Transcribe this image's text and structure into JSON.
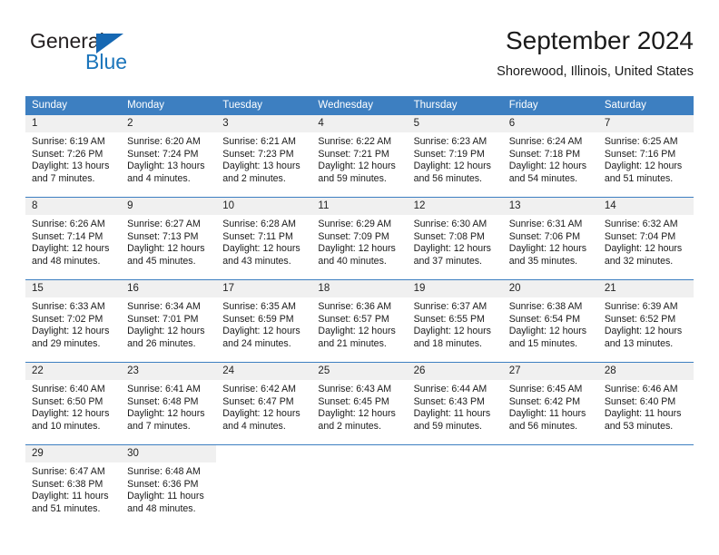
{
  "brand": {
    "name_top": "General",
    "name_bottom": "Blue",
    "triangle_color": "#1668b3",
    "blue_color": "#1b75bb"
  },
  "header": {
    "title": "September 2024",
    "location": "Shorewood, Illinois, United States"
  },
  "theme": {
    "header_bg": "#3d7fc1",
    "daynum_bg": "#f0f0f0",
    "grid_line": "#3d7fc1",
    "text": "#1a1a1a"
  },
  "weekday_headers": [
    "Sunday",
    "Monday",
    "Tuesday",
    "Wednesday",
    "Thursday",
    "Friday",
    "Saturday"
  ],
  "labels": {
    "sunrise_prefix": "Sunrise: ",
    "sunset_prefix": "Sunset: ",
    "daylight_prefix": "Daylight: "
  },
  "weeks": [
    [
      {
        "day": "1",
        "sunrise": "Sunrise: 6:19 AM",
        "sunset": "Sunset: 7:26 PM",
        "daylight": "Daylight: 13 hours and 7 minutes."
      },
      {
        "day": "2",
        "sunrise": "Sunrise: 6:20 AM",
        "sunset": "Sunset: 7:24 PM",
        "daylight": "Daylight: 13 hours and 4 minutes."
      },
      {
        "day": "3",
        "sunrise": "Sunrise: 6:21 AM",
        "sunset": "Sunset: 7:23 PM",
        "daylight": "Daylight: 13 hours and 2 minutes."
      },
      {
        "day": "4",
        "sunrise": "Sunrise: 6:22 AM",
        "sunset": "Sunset: 7:21 PM",
        "daylight": "Daylight: 12 hours and 59 minutes."
      },
      {
        "day": "5",
        "sunrise": "Sunrise: 6:23 AM",
        "sunset": "Sunset: 7:19 PM",
        "daylight": "Daylight: 12 hours and 56 minutes."
      },
      {
        "day": "6",
        "sunrise": "Sunrise: 6:24 AM",
        "sunset": "Sunset: 7:18 PM",
        "daylight": "Daylight: 12 hours and 54 minutes."
      },
      {
        "day": "7",
        "sunrise": "Sunrise: 6:25 AM",
        "sunset": "Sunset: 7:16 PM",
        "daylight": "Daylight: 12 hours and 51 minutes."
      }
    ],
    [
      {
        "day": "8",
        "sunrise": "Sunrise: 6:26 AM",
        "sunset": "Sunset: 7:14 PM",
        "daylight": "Daylight: 12 hours and 48 minutes."
      },
      {
        "day": "9",
        "sunrise": "Sunrise: 6:27 AM",
        "sunset": "Sunset: 7:13 PM",
        "daylight": "Daylight: 12 hours and 45 minutes."
      },
      {
        "day": "10",
        "sunrise": "Sunrise: 6:28 AM",
        "sunset": "Sunset: 7:11 PM",
        "daylight": "Daylight: 12 hours and 43 minutes."
      },
      {
        "day": "11",
        "sunrise": "Sunrise: 6:29 AM",
        "sunset": "Sunset: 7:09 PM",
        "daylight": "Daylight: 12 hours and 40 minutes."
      },
      {
        "day": "12",
        "sunrise": "Sunrise: 6:30 AM",
        "sunset": "Sunset: 7:08 PM",
        "daylight": "Daylight: 12 hours and 37 minutes."
      },
      {
        "day": "13",
        "sunrise": "Sunrise: 6:31 AM",
        "sunset": "Sunset: 7:06 PM",
        "daylight": "Daylight: 12 hours and 35 minutes."
      },
      {
        "day": "14",
        "sunrise": "Sunrise: 6:32 AM",
        "sunset": "Sunset: 7:04 PM",
        "daylight": "Daylight: 12 hours and 32 minutes."
      }
    ],
    [
      {
        "day": "15",
        "sunrise": "Sunrise: 6:33 AM",
        "sunset": "Sunset: 7:02 PM",
        "daylight": "Daylight: 12 hours and 29 minutes."
      },
      {
        "day": "16",
        "sunrise": "Sunrise: 6:34 AM",
        "sunset": "Sunset: 7:01 PM",
        "daylight": "Daylight: 12 hours and 26 minutes."
      },
      {
        "day": "17",
        "sunrise": "Sunrise: 6:35 AM",
        "sunset": "Sunset: 6:59 PM",
        "daylight": "Daylight: 12 hours and 24 minutes."
      },
      {
        "day": "18",
        "sunrise": "Sunrise: 6:36 AM",
        "sunset": "Sunset: 6:57 PM",
        "daylight": "Daylight: 12 hours and 21 minutes."
      },
      {
        "day": "19",
        "sunrise": "Sunrise: 6:37 AM",
        "sunset": "Sunset: 6:55 PM",
        "daylight": "Daylight: 12 hours and 18 minutes."
      },
      {
        "day": "20",
        "sunrise": "Sunrise: 6:38 AM",
        "sunset": "Sunset: 6:54 PM",
        "daylight": "Daylight: 12 hours and 15 minutes."
      },
      {
        "day": "21",
        "sunrise": "Sunrise: 6:39 AM",
        "sunset": "Sunset: 6:52 PM",
        "daylight": "Daylight: 12 hours and 13 minutes."
      }
    ],
    [
      {
        "day": "22",
        "sunrise": "Sunrise: 6:40 AM",
        "sunset": "Sunset: 6:50 PM",
        "daylight": "Daylight: 12 hours and 10 minutes."
      },
      {
        "day": "23",
        "sunrise": "Sunrise: 6:41 AM",
        "sunset": "Sunset: 6:48 PM",
        "daylight": "Daylight: 12 hours and 7 minutes."
      },
      {
        "day": "24",
        "sunrise": "Sunrise: 6:42 AM",
        "sunset": "Sunset: 6:47 PM",
        "daylight": "Daylight: 12 hours and 4 minutes."
      },
      {
        "day": "25",
        "sunrise": "Sunrise: 6:43 AM",
        "sunset": "Sunset: 6:45 PM",
        "daylight": "Daylight: 12 hours and 2 minutes."
      },
      {
        "day": "26",
        "sunrise": "Sunrise: 6:44 AM",
        "sunset": "Sunset: 6:43 PM",
        "daylight": "Daylight: 11 hours and 59 minutes."
      },
      {
        "day": "27",
        "sunrise": "Sunrise: 6:45 AM",
        "sunset": "Sunset: 6:42 PM",
        "daylight": "Daylight: 11 hours and 56 minutes."
      },
      {
        "day": "28",
        "sunrise": "Sunrise: 6:46 AM",
        "sunset": "Sunset: 6:40 PM",
        "daylight": "Daylight: 11 hours and 53 minutes."
      }
    ],
    [
      {
        "day": "29",
        "sunrise": "Sunrise: 6:47 AM",
        "sunset": "Sunset: 6:38 PM",
        "daylight": "Daylight: 11 hours and 51 minutes."
      },
      {
        "day": "30",
        "sunrise": "Sunrise: 6:48 AM",
        "sunset": "Sunset: 6:36 PM",
        "daylight": "Daylight: 11 hours and 48 minutes."
      },
      {
        "day": "",
        "sunrise": "",
        "sunset": "",
        "daylight": ""
      },
      {
        "day": "",
        "sunrise": "",
        "sunset": "",
        "daylight": ""
      },
      {
        "day": "",
        "sunrise": "",
        "sunset": "",
        "daylight": ""
      },
      {
        "day": "",
        "sunrise": "",
        "sunset": "",
        "daylight": ""
      },
      {
        "day": "",
        "sunrise": "",
        "sunset": "",
        "daylight": ""
      }
    ]
  ]
}
